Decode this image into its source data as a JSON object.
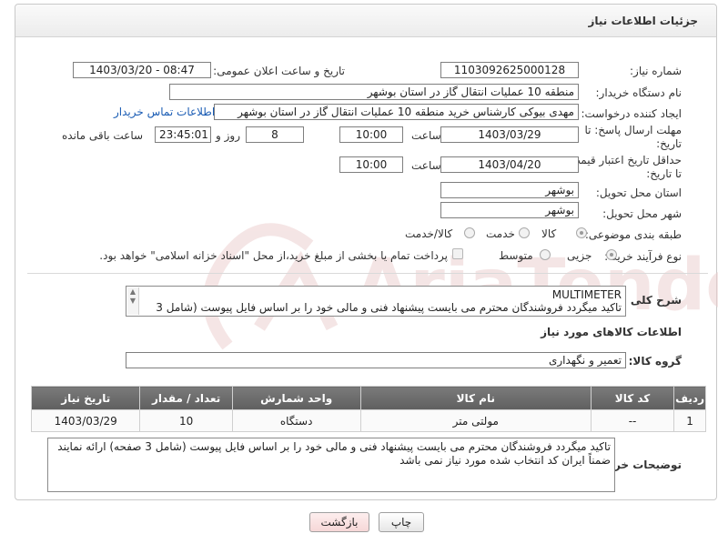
{
  "page": {
    "title": "جزئیات اطلاعات نیاز"
  },
  "fields": {
    "need_number_label": "شماره نیاز:",
    "need_number": "1103092625000128",
    "announce_label": "تاریخ و ساعت اعلان عمومی:",
    "announce_value": "1403/03/20 - 08:47",
    "buyer_label": "نام دستگاه خریدار:",
    "buyer_value": "منطقه 10 عملیات انتقال گاز در استان بوشهر",
    "creator_label": "ایجاد کننده درخواست:",
    "creator_value": "مهدی بیوکی کارشناس خرید منطقه 10 عملیات انتقال گاز در استان بوشهر",
    "contact_link": "اطلاعات تماس خریدار",
    "reply_deadline_label": "مهلت ارسال پاسخ: تا تاریخ:",
    "reply_date": "1403/03/29",
    "time_label": "ساعت",
    "reply_time": "10:00",
    "days_value": "8",
    "days_label": "روز و",
    "remaining_time": "23:45:01",
    "remaining_label": "ساعت باقی مانده",
    "validity_label": "حداقل تاریخ اعتبار قیمت: تا تاریخ:",
    "validity_date": "1403/04/20",
    "validity_time": "10:00",
    "province_label": "استان محل تحویل:",
    "province_value": "بوشهر",
    "city_label": "شهر محل تحویل:",
    "city_value": "بوشهر",
    "category_label": "طبقه بندی موضوعی:",
    "category_options": [
      "کالا",
      "خدمت",
      "کالا/خدمت"
    ],
    "category_selected": "کالا",
    "process_label": "نوع فرآیند خرید :",
    "process_options": [
      "جزیی",
      "متوسط"
    ],
    "process_selected": "جزیی",
    "payment_note": "پرداخت تمام یا بخشی از مبلغ خرید،از محل \"اسناد خزانه اسلامی\" خواهد بود."
  },
  "description": {
    "label": "شرح کلی نیاز:",
    "text": "MULTIMETER\nتاکید میگردد فروشندگان محترم می بایست پیشنهاد فنی و مالی خود را بر اساس فایل پیوست (شامل 3"
  },
  "goods": {
    "section_label": "اطلاعات کالاهای مورد نیاز",
    "group_label": "گروه کالا:",
    "group_value": "تعمیر و نگهداری",
    "columns": [
      "ردیف",
      "کد کالا",
      "نام کالا",
      "واحد شمارش",
      "تعداد / مقدار",
      "تاریخ نیاز"
    ],
    "rows": [
      {
        "row": "1",
        "code": "--",
        "name": "مولتی متر",
        "unit": "دستگاه",
        "qty": "10",
        "date": "1403/03/29"
      }
    ]
  },
  "buyer_notes": {
    "label": "توضیحات خریدار:",
    "text": "تاکید میگردد فروشندگان محترم می بایست پیشنهاد فنی و مالی خود را بر اساس فایل پیوست (شامل 3 صفحه) ارائه نمایند ضمناً ایران کد انتخاب شده مورد نیاز نمی باشد"
  },
  "buttons": {
    "print": "چاپ",
    "back": "بازگشت"
  },
  "watermark": {
    "text": "AriaTender.net"
  },
  "colors": {
    "link": "#1a5cb4",
    "table_header": "#6b6b6b",
    "back_button_bg": "#fbe3e3",
    "watermark": "#e2b8b8"
  }
}
